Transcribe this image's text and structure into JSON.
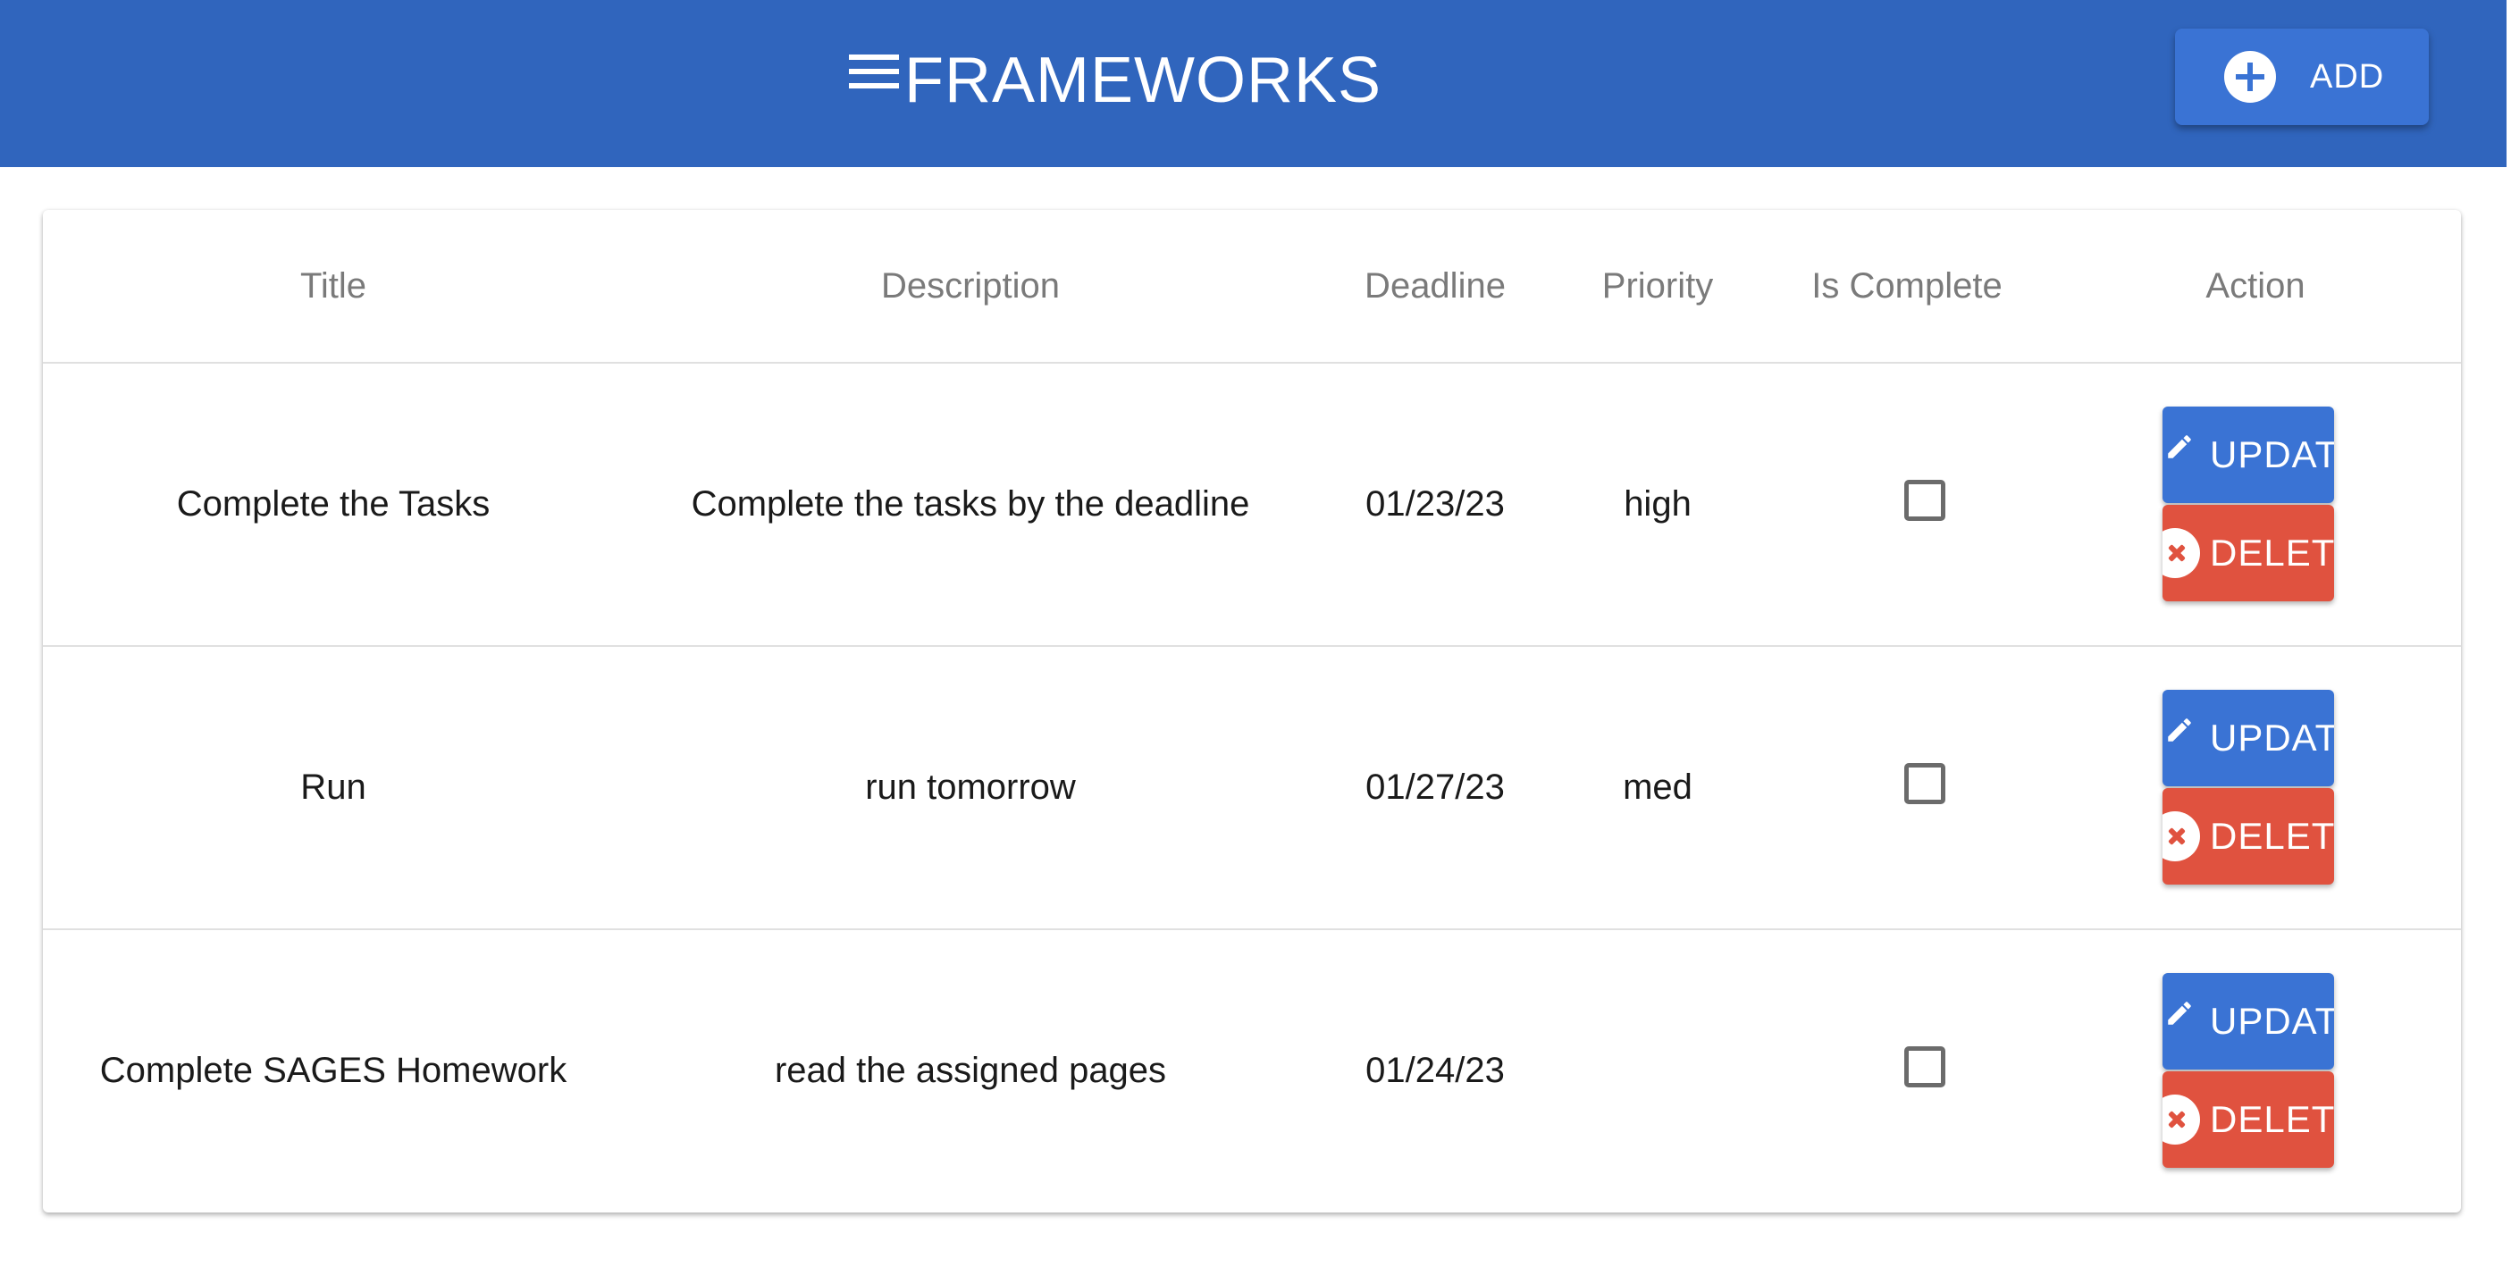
{
  "header": {
    "title": "FRAMEWORKS",
    "add_label": "ADD",
    "menu_icon": "menu-icon",
    "add_icon": "add-circle-icon",
    "background_color": "#3065bd",
    "button_color": "#3a73d4"
  },
  "table": {
    "columns": [
      "Title",
      "Description",
      "Deadline",
      "Priority",
      "Is Complete",
      "Action"
    ],
    "rows": [
      {
        "title": "Complete the Tasks",
        "description": "Complete the tasks by the deadline",
        "deadline": "01/23/23",
        "priority": "high",
        "is_complete": false,
        "update_label": "UPDAT",
        "delete_label": "DELET"
      },
      {
        "title": "Run",
        "description": "run tomorrow",
        "deadline": "01/27/23",
        "priority": "med",
        "is_complete": false,
        "update_label": "UPDAT",
        "delete_label": "DELET"
      },
      {
        "title": "Complete SAGES Homework",
        "description": "read the assigned pages",
        "deadline": "01/24/23",
        "priority": "",
        "is_complete": false,
        "update_label": "UPDAT",
        "delete_label": "DELET"
      }
    ],
    "update_color": "#3a73d4",
    "delete_color": "#e0523f",
    "update_icon": "pencil-icon",
    "delete_icon": "cancel-icon"
  }
}
